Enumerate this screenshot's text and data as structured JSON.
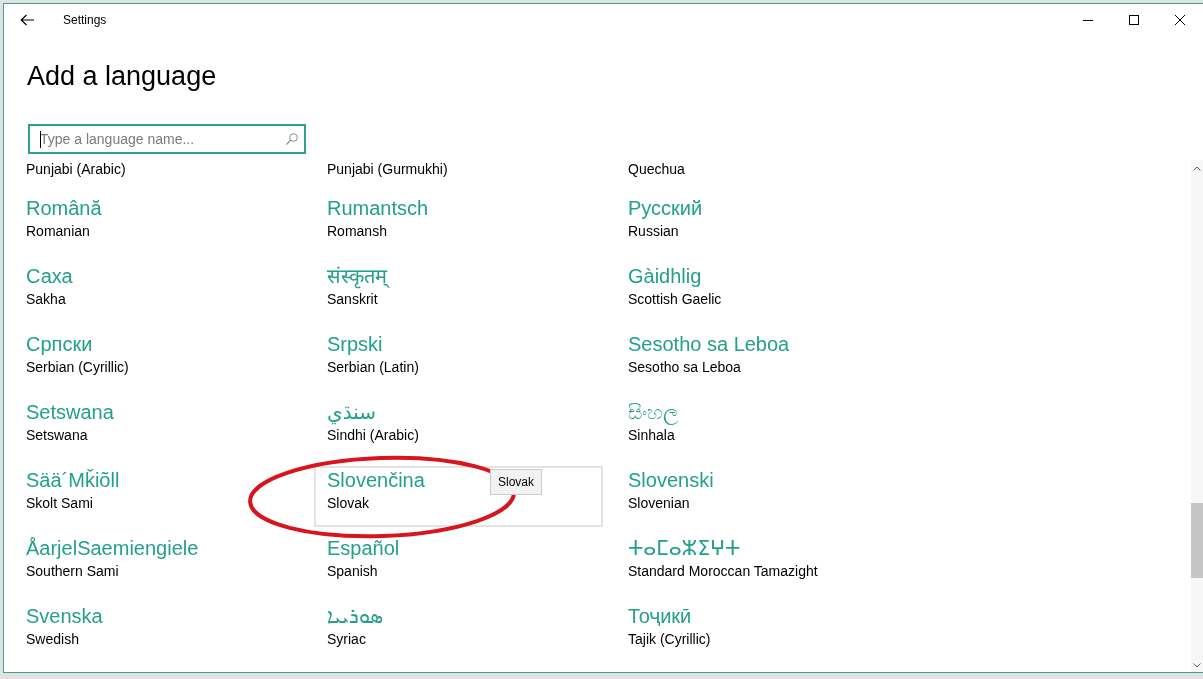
{
  "window": {
    "title": "Settings"
  },
  "heading": "Add a language",
  "search": {
    "placeholder": "Type a language name...",
    "focused": true
  },
  "languages": [
    {
      "name": "Punjabi (Arabic)",
      "hovered": false,
      "circled": false
    },
    {
      "name": "Punjabi (Gurmukhi)",
      "hovered": false,
      "circled": false
    },
    {
      "name": "Quechua",
      "hovered": false,
      "circled": false
    },
    {
      "native": "Română",
      "name": "Romanian",
      "hovered": false,
      "circled": false
    },
    {
      "native": "Rumantsch",
      "name": "Romansh",
      "hovered": false,
      "circled": false
    },
    {
      "native": "Русский",
      "name": "Russian",
      "hovered": false,
      "circled": false
    },
    {
      "native": "Саха",
      "name": "Sakha",
      "hovered": false,
      "circled": false
    },
    {
      "native": "संस्कृतम्",
      "name": "Sanskrit",
      "hovered": false,
      "circled": false
    },
    {
      "native": "Gàidhlig",
      "name": "Scottish Gaelic",
      "hovered": false,
      "circled": false
    },
    {
      "native": "Српски",
      "name": "Serbian (Cyrillic)",
      "hovered": false,
      "circled": false
    },
    {
      "native": "Srpski",
      "name": "Serbian (Latin)",
      "hovered": false,
      "circled": false
    },
    {
      "native": "Sesotho sa Leboa",
      "name": "Sesotho sa Leboa",
      "hovered": false,
      "circled": false
    },
    {
      "native": "Setswana",
      "name": "Setswana",
      "hovered": false,
      "circled": false
    },
    {
      "native": "سنڌي",
      "name": "Sindhi (Arabic)",
      "hovered": false,
      "circled": false
    },
    {
      "native": "සිංහල",
      "name": "Sinhala",
      "hovered": false,
      "circled": false
    },
    {
      "native": "Sää´Mǩiõll",
      "name": "Skolt Sami",
      "hovered": false,
      "circled": false
    },
    {
      "native": "Slovenčina",
      "name": "Slovak",
      "hovered": true,
      "circled": true,
      "tooltip": "Slovak"
    },
    {
      "native": "Slovenski",
      "name": "Slovenian",
      "hovered": false,
      "circled": false
    },
    {
      "native": "ÅarjelSaemiengiele",
      "name": "Southern Sami",
      "hovered": false,
      "circled": false
    },
    {
      "native": "Español",
      "name": "Spanish",
      "hovered": false,
      "circled": false
    },
    {
      "native": "ⵜⴰⵎⴰⵣⵉⵖⵜ",
      "name": "Standard Moroccan Tamazight",
      "hovered": false,
      "circled": false
    },
    {
      "native": "Svenska",
      "name": "Swedish",
      "hovered": false,
      "circled": false
    },
    {
      "native": "ܣܘܪܝܝܐ",
      "name": "Syriac",
      "hovered": false,
      "circled": false
    },
    {
      "native": "Тоҷикӣ",
      "name": "Tajik (Cyrillic)",
      "hovered": false,
      "circled": false
    }
  ]
}
